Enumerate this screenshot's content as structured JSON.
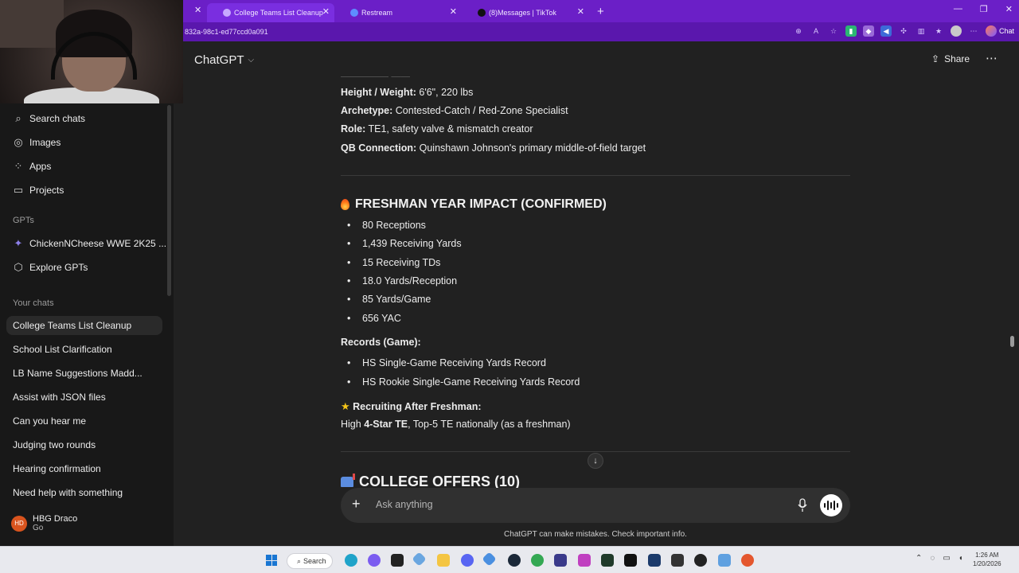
{
  "browser": {
    "tabs": [
      {
        "title": "College Teams List Cleanup",
        "active": true
      },
      {
        "title": "Restream",
        "active": false
      },
      {
        "title": "(8)Messages | TikTok",
        "active": false
      }
    ],
    "new_tab_icon": "plus-icon",
    "url": "832a-98c1-ed77ccd0a091",
    "chat_button_label": "Chat"
  },
  "sidebar": {
    "top_items": [
      {
        "label": "Search chats",
        "icon": "search-icon"
      },
      {
        "label": "Images",
        "icon": "images-icon"
      },
      {
        "label": "Apps",
        "icon": "apps-icon"
      },
      {
        "label": "Projects",
        "icon": "folder-icon"
      }
    ],
    "gpts_heading": "GPTs",
    "gpts": [
      {
        "label": "ChickenNCheese WWE 2K25 ...",
        "icon": "gpt-avatar-icon"
      },
      {
        "label": "Explore GPTs",
        "icon": "explore-icon"
      }
    ],
    "chats_heading": "Your chats",
    "chats": [
      "College Teams List Cleanup",
      "School List Clarification",
      "LB Name Suggestions Madd...",
      "Assist with JSON files",
      "Can you hear me",
      "Judging two rounds",
      "Hearing confirmation",
      "Need help with something"
    ],
    "profile": {
      "initials": "HD",
      "name": "HBG Draco",
      "plan": "Go"
    }
  },
  "header": {
    "model": "ChatGPT",
    "share_label": "Share"
  },
  "message": {
    "profile_lines": [
      {
        "label": "Height / Weight:",
        "value": "6'6\", 220 lbs"
      },
      {
        "label": "Archetype:",
        "value": "Contested-Catch / Red-Zone Specialist"
      },
      {
        "label": "Role:",
        "value": "TE1, safety valve & mismatch creator"
      },
      {
        "label": "QB Connection:",
        "value": "Quinshawn Johnson's primary middle-of-field target"
      }
    ],
    "impact_heading": "FRESHMAN YEAR IMPACT (CONFIRMED)",
    "impact_stats": [
      "80 Receptions",
      "1,439 Receiving Yards",
      "15 Receiving TDs",
      "18.0 Yards/Reception",
      "85 Yards/Game",
      "656 YAC"
    ],
    "records_heading": "Records (Game):",
    "records": [
      "HS Single-Game Receiving Yards Record",
      "HS Rookie Single-Game Receiving Yards Record"
    ],
    "recruiting_heading": "Recruiting After Freshman:",
    "recruiting_pre": "High ",
    "recruiting_bold": "4-Star TE",
    "recruiting_post": ", Top-5 TE nationally (as a freshman)",
    "offers_heading": "COLLEGE OFFERS (10)"
  },
  "composer": {
    "placeholder": "Ask anything",
    "disclaimer": "ChatGPT can make mistakes. Check important info."
  },
  "taskbar": {
    "search_label": "Search",
    "time": "1:26 AM",
    "date": "1/20/2026"
  }
}
